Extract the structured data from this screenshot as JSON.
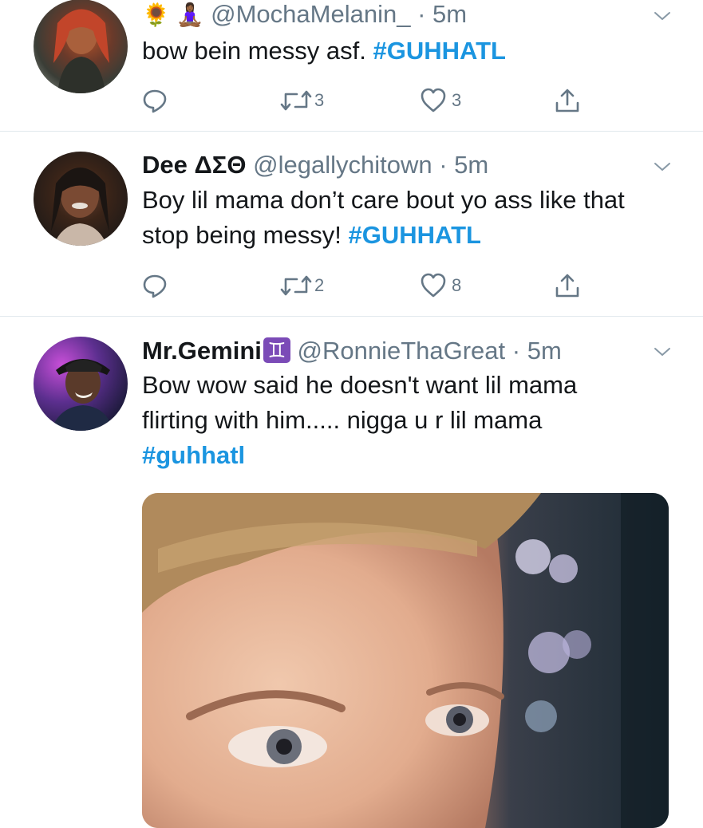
{
  "tweets": [
    {
      "display_name": "",
      "name_emoji": "🌻 🧘🏾‍♀️",
      "handle": "@MochaMelanin_",
      "dot": "·",
      "time": "5m",
      "text": "bow bein messy asf.",
      "hashtag": "#GUHHATL",
      "retweets": "3",
      "likes": "3"
    },
    {
      "display_name": "Dee ΔΣΘ",
      "handle": "@legallychitown",
      "dot": "·",
      "time": "5m",
      "text": "Boy lil mama don’t care bout yo ass like that stop being messy!",
      "hashtag": "#GUHHATL",
      "retweets": "2",
      "likes": "8"
    },
    {
      "display_name": "Mr.Gemini",
      "name_emoji": "♊",
      "handle": "@RonnieThaGreat",
      "dot": "·",
      "time": "5m",
      "text": "Bow wow said he doesn't want lil mama flirting with him..... nigga u r lil mama",
      "hashtag": "#guhhatl",
      "retweets": "",
      "likes": ""
    }
  ],
  "icons": {
    "reply": "reply-icon",
    "retweet": "retweet-icon",
    "like": "heart-icon",
    "share": "share-icon",
    "caret": "chevron-down-icon"
  },
  "colors": {
    "hashtag": "#1b95e0",
    "secondary_text": "#657786",
    "divider": "#e1e8ed",
    "gemini_badge": "#7b4bb7"
  }
}
